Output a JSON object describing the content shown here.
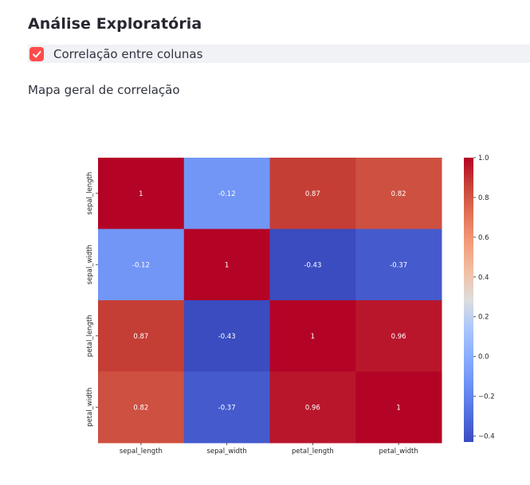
{
  "header": {
    "title": "Análise Exploratória"
  },
  "controls": {
    "checkbox_label": "Correlação entre colunas",
    "checkbox_checked": true,
    "accent": "#ff4b4b"
  },
  "section": {
    "subtitle": "Mapa geral de correlação"
  },
  "chart_data": {
    "type": "heatmap",
    "title": "",
    "xlabel": "",
    "ylabel": "",
    "x_categories": [
      "sepal_length",
      "sepal_width",
      "petal_length",
      "petal_width"
    ],
    "y_categories": [
      "sepal_length",
      "sepal_width",
      "petal_length",
      "petal_width"
    ],
    "values": [
      [
        1,
        -0.12,
        0.87,
        0.82
      ],
      [
        -0.12,
        1,
        -0.43,
        -0.37
      ],
      [
        0.87,
        -0.43,
        1,
        0.96
      ],
      [
        0.82,
        -0.37,
        0.96,
        1
      ]
    ],
    "value_labels": [
      [
        "1",
        "-0.12",
        "0.87",
        "0.82"
      ],
      [
        "-0.12",
        "1",
        "-0.43",
        "-0.37"
      ],
      [
        "0.87",
        "-0.43",
        "1",
        "0.96"
      ],
      [
        "0.82",
        "-0.37",
        "0.96",
        "1"
      ]
    ],
    "colormap": "coolwarm",
    "vmin": -0.43,
    "vmax": 1.0,
    "colorbar_ticks": [
      1.0,
      0.8,
      0.6,
      0.4,
      0.2,
      0.0,
      -0.2,
      -0.4
    ],
    "colorbar_tick_labels": [
      "1.0",
      "0.8",
      "0.6",
      "0.4",
      "0.2",
      "0.0",
      "−0.2",
      "−0.4"
    ]
  }
}
